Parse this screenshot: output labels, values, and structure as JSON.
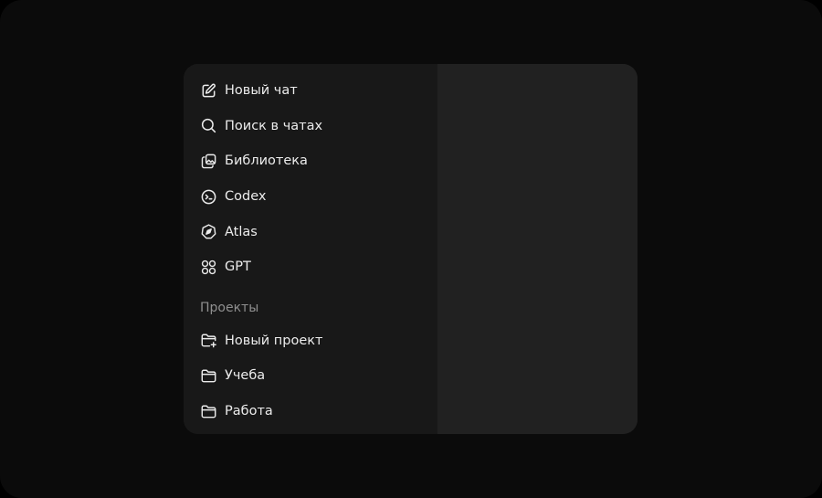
{
  "sidebar": {
    "nav": [
      {
        "label": "Новый чат",
        "icon": "edit-icon"
      },
      {
        "label": "Поиск в чатах",
        "icon": "search-icon"
      },
      {
        "label": "Библиотека",
        "icon": "library-icon"
      },
      {
        "label": "Codex",
        "icon": "terminal-icon"
      },
      {
        "label": "Atlas",
        "icon": "compass-icon"
      },
      {
        "label": "GPT",
        "icon": "grid-icon"
      }
    ],
    "projects": {
      "title": "Проекты",
      "items": [
        {
          "label": "Новый проект",
          "icon": "folder-plus-icon"
        },
        {
          "label": "Учеба",
          "icon": "folder-icon"
        },
        {
          "label": "Работа",
          "icon": "folder-icon"
        }
      ]
    }
  },
  "colors": {
    "background": "#0b0b0b",
    "sidebar": "#181818",
    "main": "#212121",
    "text": "#ececec",
    "muted": "#8f8f8f"
  }
}
